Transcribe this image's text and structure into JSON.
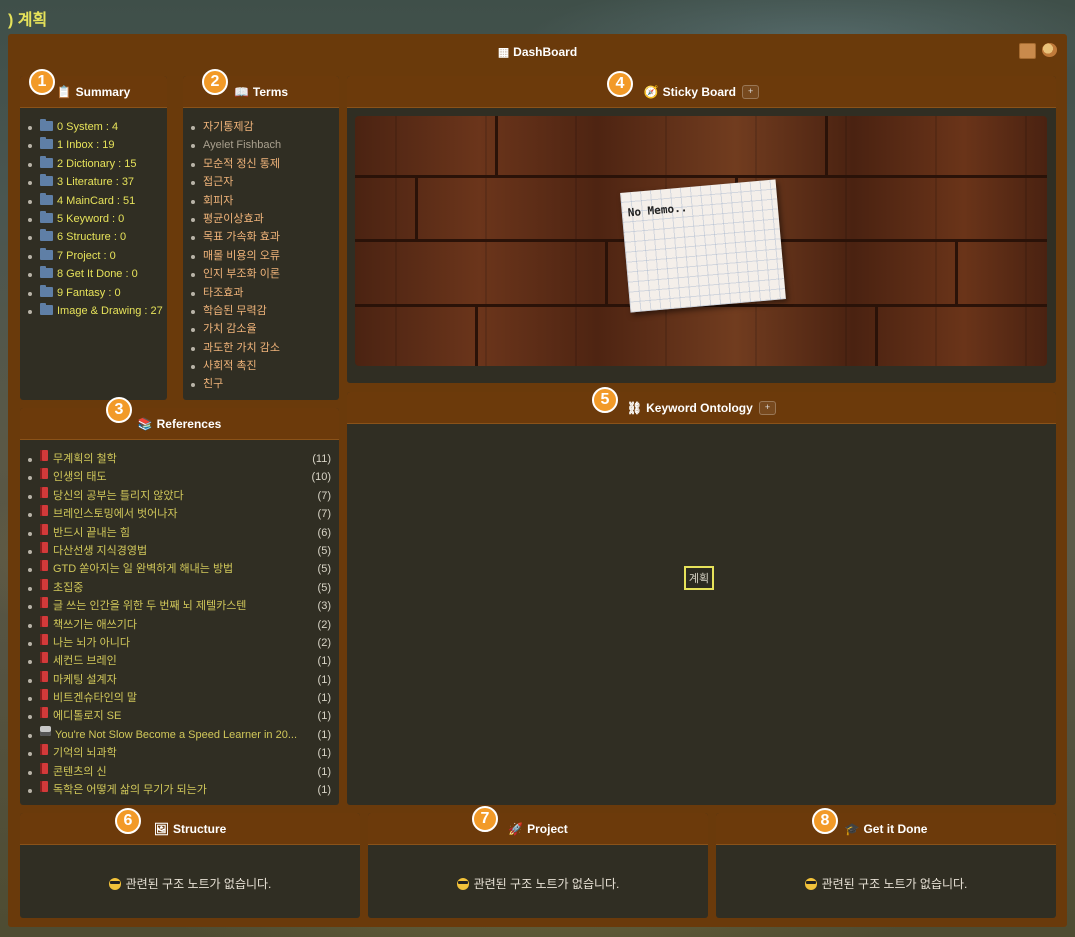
{
  "page": {
    "title": ") 계획"
  },
  "dashboard": {
    "title": "DashBoard",
    "grid_icon": "▦",
    "tools": [
      "box-icon",
      "palette-icon"
    ]
  },
  "badges": [
    "1",
    "2",
    "3",
    "4",
    "5",
    "6",
    "7",
    "8"
  ],
  "summary": {
    "title": "Summary",
    "items": [
      "0 System : 4",
      "1 Inbox : 19",
      "2 Dictionary : 15",
      "3 Literature : 37",
      "4 MainCard : 51",
      "5 Keyword : 0",
      "6 Structure : 0",
      "7 Project : 0",
      "8 Get It Done : 0",
      "9 Fantasy : 0",
      "Image & Drawing : 27"
    ]
  },
  "terms": {
    "title": "Terms",
    "items": [
      "자기통제감",
      "Ayelet Fishbach",
      "모순적 정신 통제",
      "접근자",
      "회피자",
      "평균이상효과",
      "목표 가속화 효과",
      "매몰 비용의 오류",
      "인지 부조화 이론",
      "타조효과",
      "학습된 무력감",
      "가치 감소율",
      "과도한 가치 감소",
      "사회적 촉진",
      "친구"
    ]
  },
  "references": {
    "title": "References",
    "items": [
      {
        "title": "무계획의 철학",
        "count": "(11)"
      },
      {
        "title": "인생의 태도",
        "count": "(10)"
      },
      {
        "title": "당신의 공부는 틀리지 않았다",
        "count": "(7)"
      },
      {
        "title": "브레인스토밍에서 벗어나자",
        "count": "(7)"
      },
      {
        "title": "반드시 끝내는 힘",
        "count": "(6)"
      },
      {
        "title": "다산선생 지식경영법",
        "count": "(5)"
      },
      {
        "title": "GTD 쏟아지는 일 완벽하게 해내는 방법",
        "count": "(5)"
      },
      {
        "title": "초집중",
        "count": "(5)"
      },
      {
        "title": "글 쓰는 인간을 위한 두 번째 뇌 제텔카스텐",
        "count": "(3)"
      },
      {
        "title": "책쓰기는 애쓰기다",
        "count": "(2)"
      },
      {
        "title": "나는 뇌가 아니다",
        "count": "(2)"
      },
      {
        "title": "세컨드 브레인",
        "count": "(1)"
      },
      {
        "title": "마케팅 설계자",
        "count": "(1)"
      },
      {
        "title": "비트겐슈타인의 말",
        "count": "(1)"
      },
      {
        "title": "에디톨로지 SE",
        "count": "(1)"
      },
      {
        "title": "You're Not Slow Become a Speed Learner in 20...",
        "count": "(1)"
      },
      {
        "title": "기억의 뇌과학",
        "count": "(1)"
      },
      {
        "title": "콘텐츠의 신",
        "count": "(1)"
      },
      {
        "title": "독학은 어떻게 삶의 무기가 되는가",
        "count": "(1)"
      }
    ]
  },
  "sticky": {
    "title": "Sticky Board",
    "add_label": "+",
    "memo": "No Memo.."
  },
  "ontology": {
    "title": "Keyword Ontology",
    "add_label": "+",
    "node": "계획"
  },
  "structure": {
    "title": "Structure",
    "empty": "관련된 구조 노트가 없습니다."
  },
  "project": {
    "title": "Project",
    "empty": "관련된 구조 노트가 없습니다."
  },
  "getitdone": {
    "title": "Get it Done",
    "empty": "관련된 구조 노트가 없습니다."
  }
}
